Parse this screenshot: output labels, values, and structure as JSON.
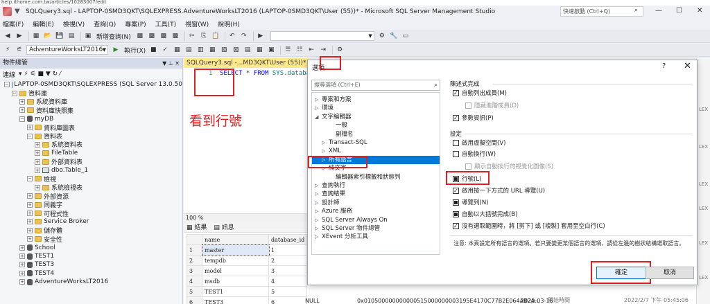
{
  "browser": {
    "url": "help.ithome.com.tw/articles/10283007/edit"
  },
  "window": {
    "title": "SQLQuery3.sql - LAPTOP-0SMD3QKT\\SQLEXPRESS.AdventureWorksLT2016 (LAPTOP-0SMD3QKT\\User (55))* - Microsoft SQL Server Management Studio",
    "quick_launch_placeholder": "快速啟動 (Ctrl+Q)"
  },
  "menu": [
    "檔案(F)",
    "編輯(E)",
    "檢視(V)",
    "查詢(Q)",
    "專案(P)",
    "工具(T)",
    "視窗(W)",
    "說明(H)"
  ],
  "toolbar1": {
    "new_query": "新增查詢(N)"
  },
  "toolbar2": {
    "database": "AdventureWorksLT2016",
    "execute": "執行(X)"
  },
  "object_explorer": {
    "title": "物件總管",
    "connect": "連線",
    "tree": [
      {
        "label": "LAPTOP-0SMD3QKT\\SQLEXPRESS (SQL Server 13.0.50",
        "level": 0,
        "icon": "server",
        "toggle": "−"
      },
      {
        "label": "資料庫",
        "level": 1,
        "icon": "folder",
        "toggle": "−"
      },
      {
        "label": "系統資料庫",
        "level": 2,
        "icon": "folder",
        "toggle": "+"
      },
      {
        "label": "資料庫快照集",
        "level": 2,
        "icon": "folder",
        "toggle": "+"
      },
      {
        "label": "myDB",
        "level": 2,
        "icon": "db",
        "toggle": "−"
      },
      {
        "label": "資料庫圖表",
        "level": 3,
        "icon": "folder",
        "toggle": "+"
      },
      {
        "label": "資料表",
        "level": 3,
        "icon": "folder",
        "toggle": "−"
      },
      {
        "label": "系統資料表",
        "level": 4,
        "icon": "folder",
        "toggle": "+"
      },
      {
        "label": "FileTable",
        "level": 4,
        "icon": "folder",
        "toggle": "+"
      },
      {
        "label": "外部資料表",
        "level": 4,
        "icon": "folder",
        "toggle": "+"
      },
      {
        "label": "dbo.Table_1",
        "level": 4,
        "icon": "table",
        "toggle": "+"
      },
      {
        "label": "檢視",
        "level": 3,
        "icon": "folder",
        "toggle": "−"
      },
      {
        "label": "系統檢視表",
        "level": 4,
        "icon": "folder",
        "toggle": "+"
      },
      {
        "label": "外部資源",
        "level": 3,
        "icon": "folder",
        "toggle": "+"
      },
      {
        "label": "同義字",
        "level": 3,
        "icon": "folder",
        "toggle": "+"
      },
      {
        "label": "可程式性",
        "level": 3,
        "icon": "folder",
        "toggle": "+"
      },
      {
        "label": "Service Broker",
        "level": 3,
        "icon": "folder",
        "toggle": "+"
      },
      {
        "label": "儲存體",
        "level": 3,
        "icon": "folder",
        "toggle": "+"
      },
      {
        "label": "安全性",
        "level": 3,
        "icon": "folder",
        "toggle": "+"
      },
      {
        "label": "School",
        "level": 2,
        "icon": "db",
        "toggle": "+"
      },
      {
        "label": "TEST1",
        "level": 2,
        "icon": "db",
        "toggle": "+"
      },
      {
        "label": "TEST3",
        "level": 2,
        "icon": "db",
        "toggle": "+"
      },
      {
        "label": "TEST4",
        "level": 2,
        "icon": "db",
        "toggle": "+"
      },
      {
        "label": "AdventureWorksLT2016",
        "level": 2,
        "icon": "db",
        "toggle": "+"
      }
    ]
  },
  "editor": {
    "tab": "SQLQuery3.sql -...MD3QKT\\User (55))*",
    "line_number": "1",
    "code_kw1": "SELECT",
    "code_star": " * ",
    "code_kw2": "FROM",
    "code_obj": " SYS.database",
    "annotation": "看到行號",
    "zoom": "100 %"
  },
  "results": {
    "tab_results": "結果",
    "tab_messages": "訊息",
    "columns": [
      "name",
      "database_id"
    ],
    "rows": [
      [
        "1",
        "master",
        "1"
      ],
      [
        "2",
        "tempdb",
        "2"
      ],
      [
        "3",
        "model",
        "3"
      ],
      [
        "4",
        "msdb",
        "4"
      ],
      [
        "5",
        "TEST1",
        "5"
      ],
      [
        "6",
        "TEST3",
        "6"
      ]
    ],
    "extra_null": "NULL",
    "extra_hex": "0x010500000000000515000000003195E4170C77B2E064AB2A...",
    "extra_date": "2020-03-16",
    "status_label": "開始時間",
    "status_time": "2022/2/7 下午 05:45:06"
  },
  "dialog": {
    "title": "選項",
    "help": "?",
    "close": "✕",
    "search_placeholder": "搜尋選項 (Ctrl+E)",
    "tree": [
      {
        "label": "專案和方案",
        "indent": 0,
        "tri": "▷"
      },
      {
        "label": "環境",
        "indent": 0,
        "tri": "▷"
      },
      {
        "label": "文字編輯器",
        "indent": 0,
        "tri": "◢"
      },
      {
        "label": "一般",
        "indent": 2,
        "tri": ""
      },
      {
        "label": "副檔名",
        "indent": 2,
        "tri": ""
      },
      {
        "label": "Transact-SQL",
        "indent": 1,
        "tri": "▷"
      },
      {
        "label": "XML",
        "indent": 1,
        "tri": "▷"
      },
      {
        "label": "所有語言",
        "indent": 1,
        "tri": "▷",
        "selected": true
      },
      {
        "label": "純文字",
        "indent": 1,
        "tri": "▷"
      },
      {
        "label": "編輯器索引標籤和狀態列",
        "indent": 2,
        "tri": ""
      },
      {
        "label": "查詢執行",
        "indent": 0,
        "tri": "▷"
      },
      {
        "label": "查詢結果",
        "indent": 0,
        "tri": "▷"
      },
      {
        "label": "設計師",
        "indent": 0,
        "tri": "▷"
      },
      {
        "label": "Azure 服務",
        "indent": 0,
        "tri": "▷"
      },
      {
        "label": "SQL Server Always On",
        "indent": 0,
        "tri": "▷"
      },
      {
        "label": "SQL Server 物件總管",
        "indent": 0,
        "tri": "▷"
      },
      {
        "label": "XEvent 分析工具",
        "indent": 0,
        "tri": "▷"
      }
    ],
    "group_statement": "陳述式完成",
    "opt_auto_list": "自動列出成員(M)",
    "opt_hide_advanced": "隱藏進階成員(D)",
    "opt_param_info": "參數資訊(P)",
    "group_settings": "設定",
    "opt_virtual_space": "啟用虛擬空間(V)",
    "opt_word_wrap": "自動換行(W)",
    "opt_wrap_glyphs": "顯示自動換行的視覺化圖像(S)",
    "opt_line_numbers": "行號(L)",
    "opt_single_click_url": "啟用按一下方式的 URL 導覽(U)",
    "opt_nav_bar": "導覽列(N)",
    "opt_brace_complete": "自動以大括號完成(B)",
    "opt_cut_copy_blank": "沒有選取範圍時，將 [剪下] 或 [複製] 套用至空白行(C)",
    "note": "注意: 本頁設定所有語言的選項。若只要變更某個語言的選項，請從左邊的樹狀結構選取語言。",
    "ok": "確定",
    "cancel": "取消"
  },
  "right_edge": [
    "LEX",
    "LEX",
    "LEX",
    "LEX",
    "LEX",
    "LEX"
  ]
}
